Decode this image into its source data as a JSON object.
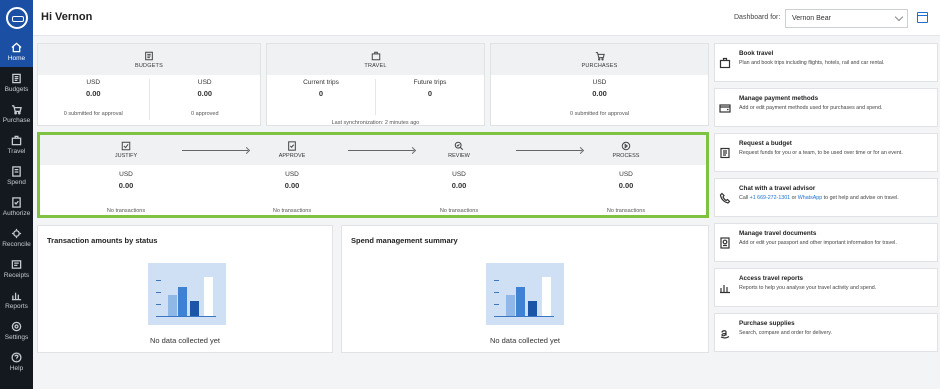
{
  "sidebar": {
    "items": [
      {
        "label": "Home",
        "icon": "home-icon",
        "active": true
      },
      {
        "label": "Budgets",
        "icon": "budget-icon"
      },
      {
        "label": "Purchase",
        "icon": "cart-icon"
      },
      {
        "label": "Travel",
        "icon": "suitcase-icon"
      },
      {
        "label": "Spend",
        "icon": "spend-icon"
      },
      {
        "label": "Authorize",
        "icon": "authorize-icon"
      },
      {
        "label": "Reconcile",
        "icon": "reconcile-icon"
      },
      {
        "label": "Receipts",
        "icon": "receipt-icon"
      },
      {
        "label": "Reports",
        "icon": "reports-icon"
      },
      {
        "label": "Settings",
        "icon": "gear-icon"
      },
      {
        "label": "Help",
        "icon": "help-icon"
      }
    ]
  },
  "header": {
    "greeting": "Hi Vernon",
    "dashboard_label": "Dashboard for:",
    "dashboard_value": "Vernon Bear"
  },
  "summary": {
    "budgets": {
      "title": "BUDGETS",
      "left": {
        "currency": "USD",
        "amount": "0.00",
        "note": "0 submitted for approval"
      },
      "right": {
        "currency": "USD",
        "amount": "0.00",
        "note": "0 approved"
      }
    },
    "travel": {
      "title": "TRAVEL",
      "left": {
        "label": "Current trips",
        "amount": "0"
      },
      "right": {
        "label": "Future trips",
        "amount": "0"
      },
      "sync": "Last synchronization: 2 minutes ago"
    },
    "purchases": {
      "title": "PURCHASES",
      "left": {
        "currency": "USD",
        "amount": "0.00",
        "note": "0 submitted for approval"
      }
    }
  },
  "workflow": {
    "steps": [
      {
        "title": "JUSTIFY",
        "currency": "USD",
        "amount": "0.00",
        "note": "No transactions"
      },
      {
        "title": "APPROVE",
        "currency": "USD",
        "amount": "0.00",
        "note": "No transactions"
      },
      {
        "title": "REVIEW",
        "currency": "USD",
        "amount": "0.00",
        "note": "No transactions"
      },
      {
        "title": "PROCESS",
        "currency": "USD",
        "amount": "0.00",
        "note": "No transactions"
      }
    ]
  },
  "panels": {
    "status": {
      "title": "Transaction amounts by status",
      "empty": "No data collected yet"
    },
    "spend": {
      "title": "Spend management summary",
      "empty": "No data collected yet"
    }
  },
  "actions": [
    {
      "title": "Book travel",
      "desc": "Plan and book trips including flights, hotels, rail and car rental.",
      "icon": "suitcase-icon"
    },
    {
      "title": "Manage payment methods",
      "desc": "Add or edit payment methods used for purchases and spend.",
      "icon": "wallet-icon"
    },
    {
      "title": "Request a budget",
      "desc": "Request funds for you or a team, to be used over time or for an event.",
      "icon": "budget-icon"
    },
    {
      "title": "Chat with a travel advisor",
      "desc_pre": "Call ",
      "phone": "+1 669-272-1301",
      "desc_mid": " or ",
      "link": "WhatsApp",
      "desc_post": " to get help and advise on travel.",
      "icon": "phone-icon"
    },
    {
      "title": "Manage travel documents",
      "desc": "Add or edit your passport and other important information for travel.",
      "icon": "passport-icon"
    },
    {
      "title": "Access travel reports",
      "desc": "Reports to help you analyse your travel activity and spend.",
      "icon": "reports-icon"
    },
    {
      "title": "Purchase supplies",
      "desc": "Search, compare and order for delivery.",
      "icon": "amazon-icon"
    }
  ],
  "colors": {
    "accent": "#1a4fa3",
    "highlight": "#7fc242",
    "link": "#1a6fd0"
  }
}
